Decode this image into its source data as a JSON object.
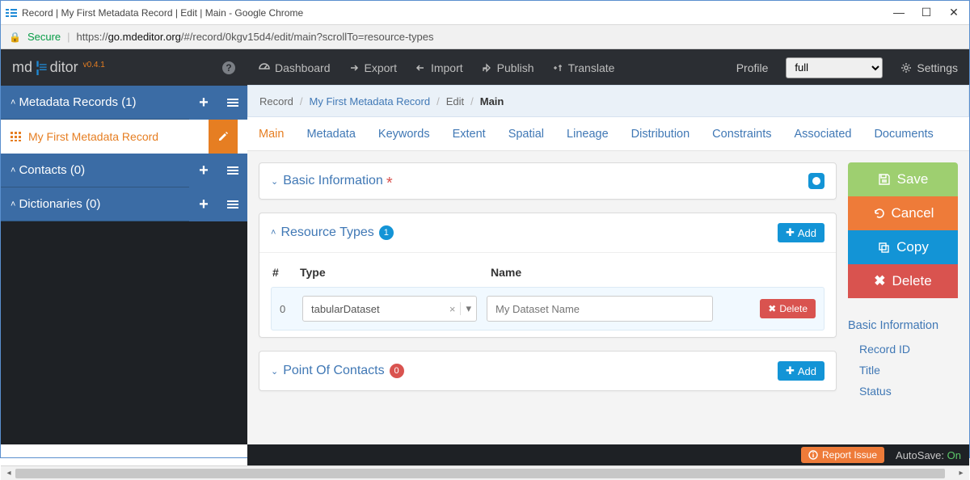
{
  "window": {
    "title": "Record | My First Metadata Record | Edit | Main - Google Chrome",
    "secure_label": "Secure",
    "url_scheme": "https://",
    "url_host": "go.mdeditor.org",
    "url_path": "/#/record/0kgv15d4/edit/main?scrollTo=resource-types"
  },
  "brand": {
    "md": "md",
    "ditor": "ditor",
    "version": "v0.4.1"
  },
  "sidebar": {
    "metadata": {
      "label": "Metadata Records",
      "count_text": "(1)"
    },
    "record_item": {
      "label": "My First Metadata Record"
    },
    "contacts": {
      "label": "Contacts",
      "count_text": "(0)"
    },
    "dictionaries": {
      "label": "Dictionaries",
      "count_text": "(0)"
    }
  },
  "topnav": {
    "dashboard": "Dashboard",
    "export": "Export",
    "import": "Import",
    "publish": "Publish",
    "translate": "Translate",
    "profile_label": "Profile",
    "profile_value": "full",
    "settings": "Settings"
  },
  "breadcrumb": {
    "record": "Record",
    "name": "My First Metadata Record",
    "edit": "Edit",
    "main": "Main"
  },
  "tabs": {
    "main": "Main",
    "metadata": "Metadata",
    "keywords": "Keywords",
    "extent": "Extent",
    "spatial": "Spatial",
    "lineage": "Lineage",
    "distribution": "Distribution",
    "constraints": "Constraints",
    "associated": "Associated",
    "documents": "Documents"
  },
  "panels": {
    "basic_info": {
      "title": "Basic Information"
    },
    "resource_types": {
      "title": "Resource Types",
      "count": "1",
      "add": "Add",
      "columns": {
        "idx": "#",
        "type": "Type",
        "name": "Name"
      },
      "row": {
        "idx": "0",
        "type_value": "tabularDataset",
        "name_placeholder": "My Dataset Name"
      },
      "delete": "Delete"
    },
    "contacts": {
      "title": "Point Of Contacts",
      "count": "0",
      "add": "Add"
    }
  },
  "actions": {
    "save": "Save",
    "cancel": "Cancel",
    "copy": "Copy",
    "delete": "Delete"
  },
  "rightnav": {
    "heading": "Basic Information",
    "record_id": "Record ID",
    "title": "Title",
    "status": "Status"
  },
  "footer": {
    "report": "Report Issue",
    "autosave_label": "AutoSave:",
    "autosave_value": "On"
  }
}
